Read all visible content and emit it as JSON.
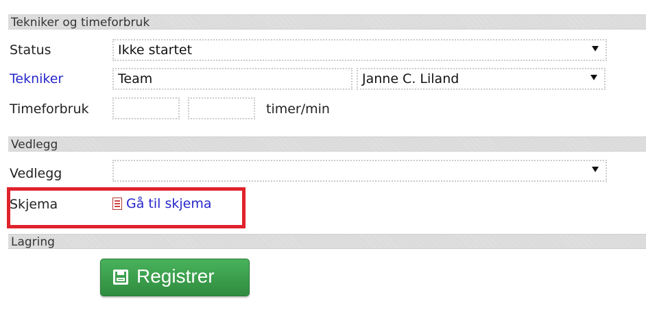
{
  "sections": {
    "tekniker": "Tekniker og timeforbruk",
    "vedlegg": "Vedlegg",
    "lagring": "Lagring"
  },
  "status": {
    "label": "Status",
    "value": "Ikke startet"
  },
  "tekniker": {
    "label": "Tekniker",
    "team_value": "Team",
    "person_value": "Janne C. Liland"
  },
  "timeforbruk": {
    "label": "Timeforbruk",
    "hours": "",
    "minutes": "",
    "unit": "timer/min"
  },
  "vedlegg": {
    "label": "Vedlegg",
    "value": ""
  },
  "skjema": {
    "label": "Skjema",
    "link": "Gå til skjema",
    "icon": "document-icon"
  },
  "actions": {
    "register_label": "Registrer",
    "register_icon": "save-icon"
  },
  "colors": {
    "link": "#2626cc",
    "button": "#3a9d4b",
    "highlight": "#e0222c"
  }
}
